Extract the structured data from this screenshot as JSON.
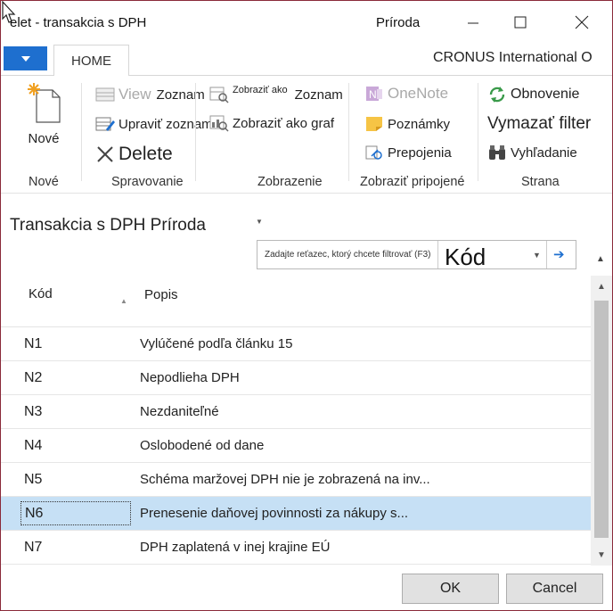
{
  "window": {
    "title": "elet - transakcia s DPH",
    "company_short": "Príroda"
  },
  "ribbon": {
    "tab_home": "HOME",
    "company_full": "CRONUS International O",
    "groups": {
      "new": {
        "label": "Nové",
        "new_button": "Nové"
      },
      "manage": {
        "label": "Spravovanie",
        "view_prefix": "View",
        "view_suffix": "Zoznam",
        "edit_list": "Upraviť zoznam",
        "delete": "Delete"
      },
      "view": {
        "label": "Zobrazenie",
        "show_as_list_prefix": "Zobraziť ako",
        "show_as_list_suffix": "Zoznam",
        "show_as_chart": "Zobraziť ako graf"
      },
      "show_attached": {
        "label": "Zobraziť pripojené",
        "onenote": "OneNote",
        "notes": "Poznámky",
        "links": "Prepojenia"
      },
      "page": {
        "label": "Strana",
        "refresh": "Obnovenie",
        "clear_filter": "Vymazať filter",
        "find": "Vyhľadanie"
      }
    }
  },
  "page": {
    "title": "Transakcia s DPH  Príroda"
  },
  "filter": {
    "placeholder": "Zadajte reťazec, ktorý chcete filtrovať (F3)",
    "field": "Kód"
  },
  "grid": {
    "columns": [
      "Kód",
      "Popis"
    ],
    "rows": [
      {
        "code": "N1",
        "description": "Vylúčené podľa článku 15"
      },
      {
        "code": "N2",
        "description": "Nepodlieha DPH"
      },
      {
        "code": "N3",
        "description": "Nezdaniteľné"
      },
      {
        "code": "N4",
        "description": "Oslobodené od dane"
      },
      {
        "code": "N5",
        "description": "Schéma maržovej DPH nie je zobrazená na inv..."
      },
      {
        "code": "N6",
        "description": "Prenesenie daňovej povinnosti za nákupy s..."
      },
      {
        "code": "N7",
        "description": "DPH zaplatená v inej krajine EÚ"
      }
    ],
    "selected_row_index": 5
  },
  "footer": {
    "ok_label": "OK",
    "cancel_label": "Cancel"
  },
  "colors": {
    "accent": "#1e6fcf",
    "selection": "#c6e0f5",
    "window_border": "#8a2a3a"
  }
}
